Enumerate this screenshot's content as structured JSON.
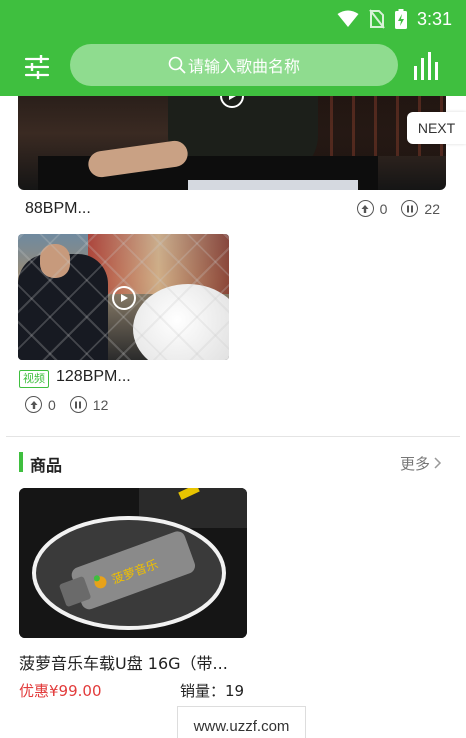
{
  "status_bar": {
    "time": "3:31"
  },
  "header": {
    "search_placeholder": "请输入歌曲名称"
  },
  "next_label": "NEXT",
  "videos": [
    {
      "title": "88BPM...",
      "likes": "0",
      "plays": "22"
    },
    {
      "badge": "视频",
      "title": "128BPM...",
      "likes": "0",
      "plays": "12"
    }
  ],
  "products_section": {
    "title": "商品",
    "more": "更多",
    "item": {
      "name": "菠萝音乐车载U盘 16G（带...",
      "price": "优惠¥99.00",
      "sales": "销量：19",
      "logo_text": "菠萝音乐"
    }
  },
  "watermark": "www.uzzf.com",
  "colors": {
    "accent": "#3fbf3f",
    "price": "#e23b3b"
  }
}
